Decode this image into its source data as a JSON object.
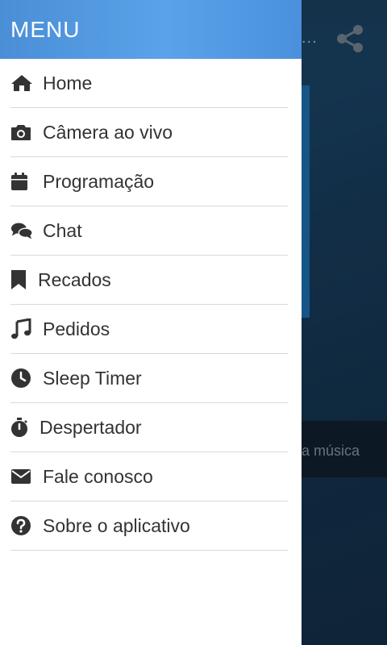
{
  "background": {
    "header_title_fragment": "...",
    "now_playing_fragment": "a música",
    "share_icon": "share-icon"
  },
  "drawer": {
    "title": "MENU",
    "items": [
      {
        "label": "Home",
        "icon": "home-icon"
      },
      {
        "label": "Câmera ao vivo",
        "icon": "camera-icon"
      },
      {
        "label": "Programação",
        "icon": "calendar-icon"
      },
      {
        "label": "Chat",
        "icon": "chat-icon"
      },
      {
        "label": "Recados",
        "icon": "bookmark-icon"
      },
      {
        "label": "Pedidos",
        "icon": "music-icon"
      },
      {
        "label": "Sleep Timer",
        "icon": "clock-icon"
      },
      {
        "label": "Despertador",
        "icon": "stopwatch-icon"
      },
      {
        "label": "Fale conosco",
        "icon": "envelope-icon"
      },
      {
        "label": "Sobre o aplicativo",
        "icon": "question-icon"
      }
    ]
  },
  "colors": {
    "drawer_header": "#4a8fd6",
    "text": "#333333",
    "divider": "#d9d9d9"
  }
}
